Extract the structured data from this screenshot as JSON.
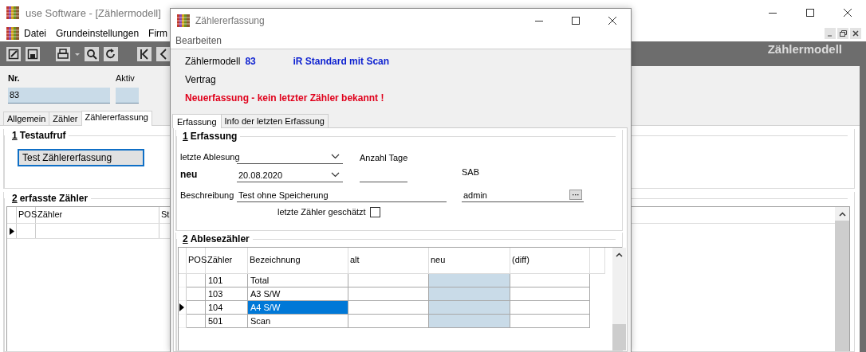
{
  "main_window": {
    "title": "use Software - [Zählermodell]",
    "menu": [
      "Datei",
      "Grundeinstellungen",
      "Firm"
    ],
    "toolbar_title": "Zählermodell",
    "fields": [
      {
        "label": "Nr.",
        "value": "83"
      },
      {
        "label": "Aktiv"
      }
    ],
    "tabs": [
      {
        "label": "Allgemein",
        "selected": false
      },
      {
        "label": "Zähler",
        "selected": false
      },
      {
        "label": "Zählererfassung",
        "selected": true
      }
    ],
    "groups": [
      {
        "number": "1",
        "title": "Testaufruf"
      },
      {
        "number": "2",
        "title": "erfasste Zähler"
      }
    ],
    "test_button": "Test Zählererfassung",
    "grid": {
      "columns": [
        "POS",
        "Zähler",
        "St"
      ],
      "rows": [
        {
          "selected": true
        }
      ]
    }
  },
  "dialog": {
    "title": "Zählererfassung",
    "menu": [
      "Bearbeiten"
    ],
    "info": {
      "model_label": "Zählermodell",
      "model_number": "83",
      "model_name": "iR Standard mit Scan",
      "contract_label": "Vertrag",
      "warning": "Neuerfassung - kein letzter Zähler bekannt !"
    },
    "tabs": [
      {
        "label": "Erfassung",
        "selected": true
      },
      {
        "label": "Info der letzten Erfassung",
        "selected": false
      }
    ],
    "capture": {
      "number": "1",
      "title": "Erfassung",
      "last_reading_label": "letzte Ablesung",
      "new_label": "neu",
      "new_date": "20.08.2020",
      "days_label": "Anzahl Tage",
      "description_label": "Beschreibung",
      "description": "Test ohne Speicherung",
      "sab_label": "SAB",
      "sab": "admin",
      "browse_button": "···",
      "estimated_label": "letzte Zähler geschätzt",
      "estimated": false
    },
    "meters": {
      "number": "2",
      "title": "Ablesezähler",
      "columns": [
        "POS",
        "Zähler",
        "Bezeichnung",
        "alt",
        "neu",
        "(diff)"
      ],
      "rows": [
        {
          "counter": "101",
          "name": "Total",
          "selected": false
        },
        {
          "counter": "103",
          "name": "A3 S/W",
          "selected": false
        },
        {
          "counter": "104",
          "name": "A4 S/W",
          "selected": true
        },
        {
          "counter": "501",
          "name": "Scan",
          "selected": false
        }
      ]
    }
  }
}
